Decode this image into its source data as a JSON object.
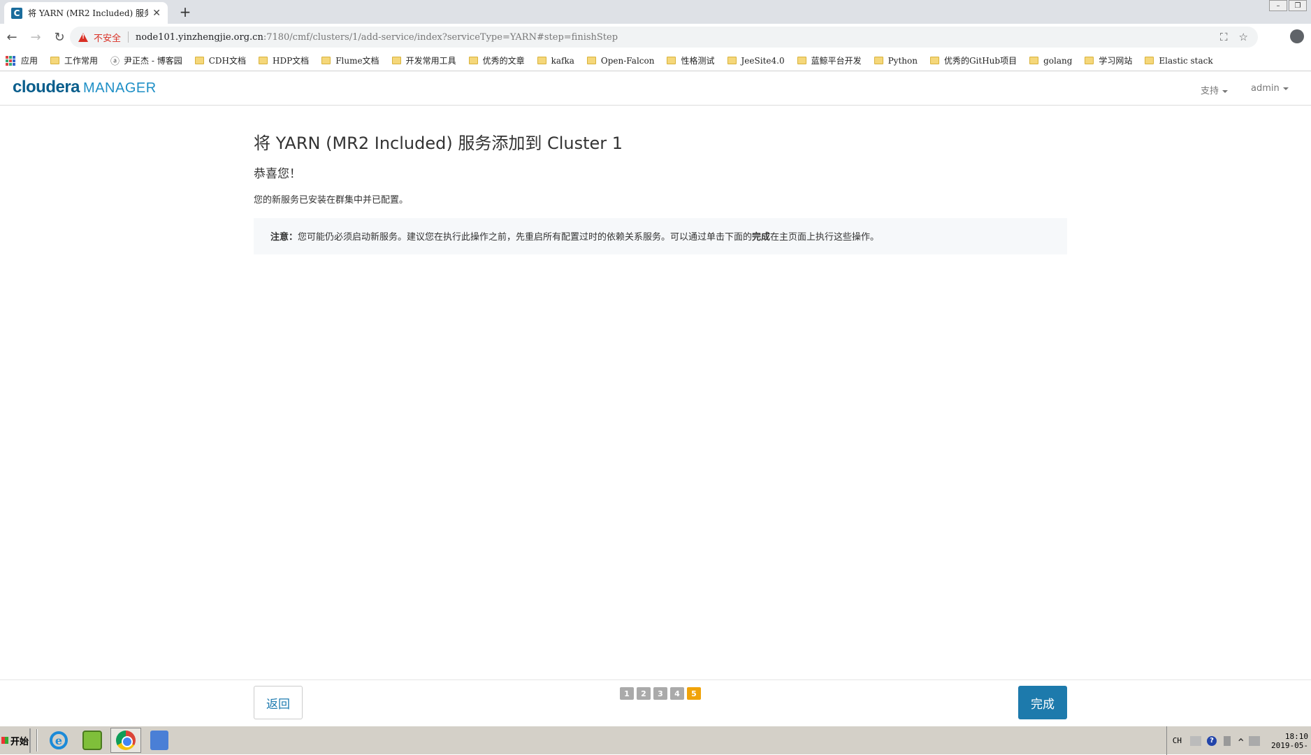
{
  "browser": {
    "tab_title": "将 YARN (MR2 Included) 服务添",
    "tab_favicon_letter": "C",
    "new_tab_glyph": "+",
    "close_glyph": "✕",
    "insecure_label": "不安全",
    "url_host": "node101.yinzhengjie.org.cn",
    "url_path": ":7180/cmf/clusters/1/add-service/index?serviceType=YARN#step=finishStep",
    "icons": [
      "back-arrow-icon",
      "forward-arrow-icon",
      "reload-icon",
      "warning-icon",
      "translate-icon",
      "star-icon",
      "profile-icon"
    ]
  },
  "bookmarks": [
    {
      "label": "应用",
      "icon": "apps-icon"
    },
    {
      "label": "工作常用",
      "icon": "folder-icon"
    },
    {
      "label": "尹正杰 - 博客园",
      "icon": "person-icon"
    },
    {
      "label": "CDH文档",
      "icon": "folder-icon"
    },
    {
      "label": "HDP文档",
      "icon": "folder-icon"
    },
    {
      "label": "Flume文档",
      "icon": "folder-icon"
    },
    {
      "label": "开发常用工具",
      "icon": "folder-icon"
    },
    {
      "label": "优秀的文章",
      "icon": "folder-icon"
    },
    {
      "label": "kafka",
      "icon": "folder-icon"
    },
    {
      "label": "Open-Falcon",
      "icon": "folder-icon"
    },
    {
      "label": "性格测试",
      "icon": "folder-icon"
    },
    {
      "label": "JeeSite4.0",
      "icon": "folder-icon"
    },
    {
      "label": "蓝鲸平台开发",
      "icon": "folder-icon"
    },
    {
      "label": "Python",
      "icon": "folder-icon"
    },
    {
      "label": "优秀的GitHub项目",
      "icon": "folder-icon"
    },
    {
      "label": "golang",
      "icon": "folder-icon"
    },
    {
      "label": "学习网站",
      "icon": "folder-icon"
    },
    {
      "label": "Elastic stack",
      "icon": "folder-icon"
    }
  ],
  "header": {
    "logo_main": "cloudera",
    "logo_sub": "MANAGER",
    "support_menu": "支持",
    "user_menu": "admin"
  },
  "main": {
    "title": "将 YARN (MR2 Included) 服务添加到 Cluster 1",
    "subtitle": "恭喜您！",
    "description": "您的新服务已安装在群集中并已配置。",
    "note_label": "注意：",
    "note_text_1": "您可能仍必须启动新服务。建议您在执行此操作之前，先重启所有配置过时的依赖关系服务。可以通过单击下面的",
    "note_bold": "完成",
    "note_text_2": "在主页面上执行这些操作。"
  },
  "footer": {
    "back_label": "返回",
    "finish_label": "完成",
    "steps": [
      "1",
      "2",
      "3",
      "4",
      "5"
    ],
    "active_step": "5"
  },
  "taskbar": {
    "start_label": "开始",
    "lang": "CH",
    "clock_time": "18:10",
    "clock_date": "2019-05-"
  },
  "colors": {
    "brand_dark": "#0a5e8c",
    "brand_light": "#1e8fc6",
    "primary_button": "#1d7aac",
    "active_step": "#f0a30a",
    "inactive_step": "#aaaaaa",
    "insecure_red": "#d93025"
  }
}
